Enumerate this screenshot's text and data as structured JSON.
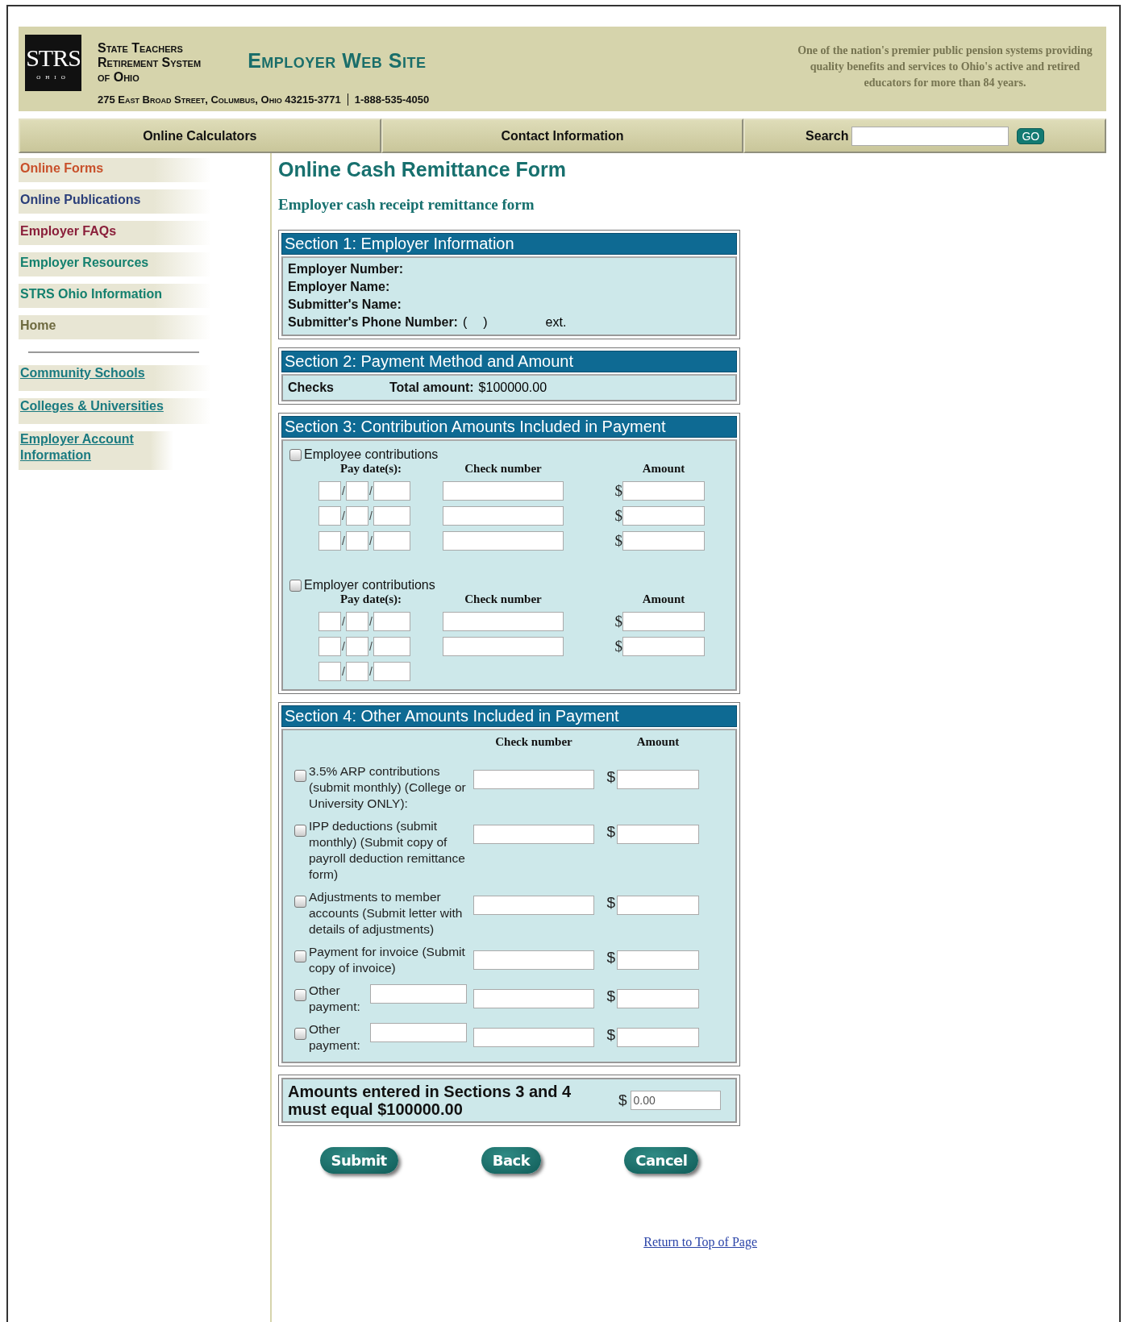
{
  "header": {
    "logo": {
      "mark": "STRS",
      "sub": "OHIO"
    },
    "org_name": [
      "State Teachers",
      "Retirement System",
      "of Ohio"
    ],
    "site_title": "Employer Web Site",
    "address": "275 East Broad Street, Columbus, Ohio 43215-3771",
    "phone": "1-888-535-4050",
    "tagline": "One of the nation's premier public pension systems providing quality benefits and services to Ohio's active and retired educators for more than 84 years."
  },
  "nav": {
    "items": [
      "Online Calculators",
      "Contact Information"
    ],
    "search": {
      "label": "Search",
      "button": "GO"
    }
  },
  "sidebar": {
    "items": [
      {
        "label": "Online Forms",
        "color": "#c8502a",
        "kind": "menu"
      },
      {
        "label": "Online Publications",
        "color": "#2b3f7a",
        "kind": "menu"
      },
      {
        "label": "Employer FAQs",
        "color": "#8a1f3a",
        "kind": "menu"
      },
      {
        "label": "Employer Resources",
        "color": "#14806e",
        "kind": "menu"
      },
      {
        "label": "STRS Ohio Information",
        "color": "#14806e",
        "kind": "menu"
      },
      {
        "label": "Home",
        "color": "#6e6a40",
        "kind": "menu"
      },
      {
        "label": "Community Schools",
        "color": "#1a7a80",
        "kind": "link"
      },
      {
        "label": "Colleges & Universities",
        "color": "#1a7a80",
        "kind": "link"
      },
      {
        "label": "Employer Account Information",
        "color": "#1a7a80",
        "kind": "link"
      }
    ]
  },
  "main": {
    "title": "Online Cash Remittance Form",
    "subtitle": "Employer cash receipt remittance form",
    "section1": {
      "title": "Section 1: Employer Information",
      "fields": [
        "Employer Number:",
        "Employer Name:",
        "Submitter's Name:"
      ],
      "phone": {
        "label": "Submitter's Phone Number:",
        "open": "(",
        "close": ")",
        "ext": "ext."
      }
    },
    "section2": {
      "title": "Section 2: Payment Method and Amount",
      "method": "Checks",
      "total_label": "Total amount:",
      "total_value": "$100000.00"
    },
    "section3": {
      "title": "Section 3: Contribution Amounts Included in Payment",
      "groups": [
        {
          "label": "Employee contributions",
          "checked": false,
          "columns": [
            "Pay date(s):",
            "Check number",
            "Amount"
          ],
          "rows": [
            {
              "kind": "full",
              "separators": [
                "/",
                "/"
              ],
              "currency": "$"
            },
            {
              "kind": "full",
              "separators": [
                "/",
                "/"
              ],
              "currency": "$"
            },
            {
              "kind": "full",
              "separators": [
                "/",
                "/"
              ],
              "currency": "$"
            }
          ]
        },
        {
          "label": "Employer contributions",
          "checked": false,
          "columns": [
            "Pay date(s):",
            "Check number",
            "Amount"
          ],
          "rows": [
            {
              "kind": "full",
              "separators": [
                "/",
                "/"
              ],
              "currency": "$"
            },
            {
              "kind": "full",
              "separators": [
                "/",
                "/"
              ],
              "currency": "$"
            },
            {
              "kind": "date_only",
              "separators": [
                "/",
                "/"
              ]
            }
          ]
        }
      ]
    },
    "section4": {
      "title": "Section 4: Other Amounts Included in Payment",
      "columns": [
        "Check number",
        "Amount"
      ],
      "items": [
        {
          "kind": "fixed",
          "label": "3.5% ARP contributions (submit monthly) (College or University ONLY):",
          "checked": false,
          "currency": "$"
        },
        {
          "kind": "fixed",
          "label": "IPP deductions (submit monthly) (Submit  copy of payroll deduction remittance form)",
          "checked": false,
          "currency": "$"
        },
        {
          "kind": "fixed",
          "label": "Adjustments to member accounts (Submit letter with details of adjustments)",
          "checked": false,
          "currency": "$"
        },
        {
          "kind": "fixed",
          "label": "Payment for invoice (Submit copy of invoice)",
          "checked": false,
          "currency": "$"
        },
        {
          "kind": "other",
          "label": "Other payment:",
          "checked": false,
          "currency": "$"
        },
        {
          "kind": "other",
          "label": "Other payment:",
          "checked": false,
          "currency": "$"
        }
      ]
    },
    "total": {
      "text": "Amounts entered in Sections 3 and 4 must equal $100000.00",
      "currency": "$",
      "value": "0.00"
    },
    "buttons": [
      "Submit",
      "Back",
      "Cancel"
    ],
    "return_link": "Return to Top of Page"
  }
}
